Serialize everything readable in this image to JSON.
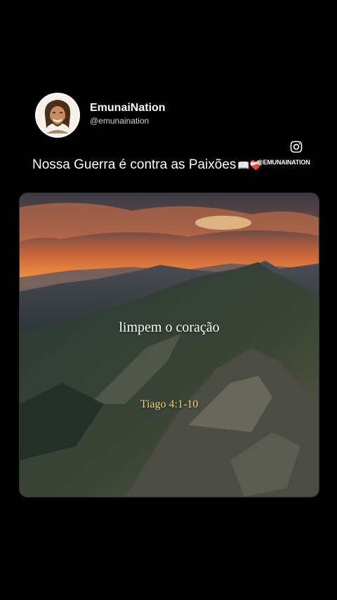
{
  "profile": {
    "display_name": "EmunaiNation",
    "handle": "@emunaination",
    "avatar_icon": "cartoon-portrait-avatar"
  },
  "caption": {
    "text": "Nossa Guerra é contra as Paixões",
    "emoji": "📖❤️‍🩹"
  },
  "watermark": "@EMUNAINATION",
  "icons": {
    "instagram": "instagram-icon"
  },
  "media": {
    "quote": "limpem o coração",
    "reference": "Tiago 4:1-10",
    "colors": {
      "quote": "#ffffff",
      "reference": "#f1d27a",
      "sky_top": "#3a3a45",
      "sky_glow": "#e8743a",
      "mountain": "#2c3a30"
    }
  }
}
